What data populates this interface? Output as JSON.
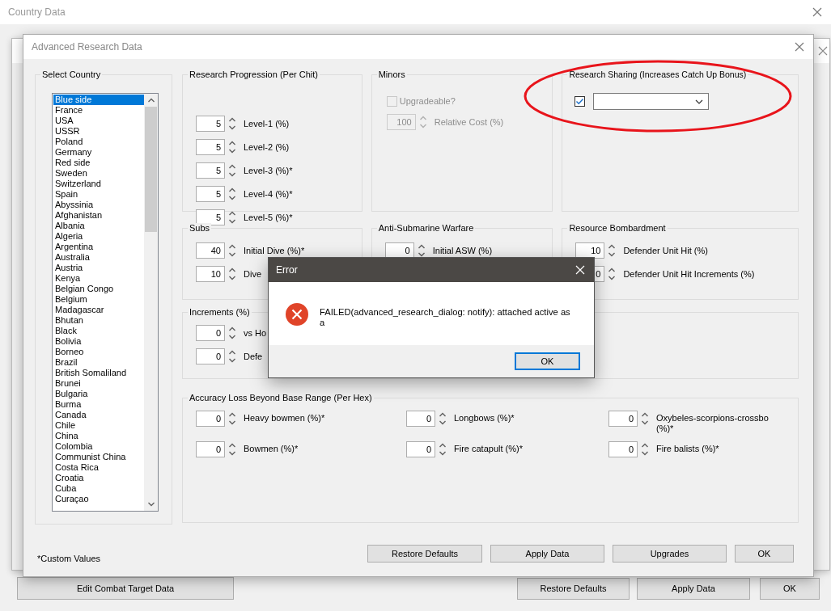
{
  "background_window": {
    "title": "Country Data",
    "buttons": [
      {
        "label": "Edit Combat Target Data"
      },
      {
        "label": "Restore Defaults"
      },
      {
        "label": "Apply Data"
      },
      {
        "label": "OK"
      }
    ]
  },
  "dialog": {
    "title": "Advanced Research Data",
    "country_list": {
      "title": "Select Country",
      "items": [
        {
          "label": "Blue side",
          "selected": true
        },
        {
          "label": "France",
          "selected": false
        },
        {
          "label": "USA",
          "selected": false
        },
        {
          "label": "USSR",
          "selected": false
        },
        {
          "label": "Poland",
          "selected": false
        },
        {
          "label": "Germany",
          "selected": false
        },
        {
          "label": "Red side",
          "selected": false
        },
        {
          "label": "Sweden",
          "selected": false
        },
        {
          "label": "Switzerland",
          "selected": false
        },
        {
          "label": "Spain",
          "selected": false
        },
        {
          "label": "Abyssinia",
          "selected": false
        },
        {
          "label": "Afghanistan",
          "selected": false
        },
        {
          "label": "Albania",
          "selected": false
        },
        {
          "label": "Algeria",
          "selected": false
        },
        {
          "label": "Argentina",
          "selected": false
        },
        {
          "label": "Australia",
          "selected": false
        },
        {
          "label": "Austria",
          "selected": false
        },
        {
          "label": "Kenya",
          "selected": false
        },
        {
          "label": "Belgian Congo",
          "selected": false
        },
        {
          "label": "Belgium",
          "selected": false
        },
        {
          "label": "Madagascar",
          "selected": false
        },
        {
          "label": "Bhutan",
          "selected": false
        },
        {
          "label": "Black",
          "selected": false
        },
        {
          "label": "Bolivia",
          "selected": false
        },
        {
          "label": "Borneo",
          "selected": false
        },
        {
          "label": "Brazil",
          "selected": false
        },
        {
          "label": "British Somaliland",
          "selected": false
        },
        {
          "label": "Brunei",
          "selected": false
        },
        {
          "label": "Bulgaria",
          "selected": false
        },
        {
          "label": "Burma",
          "selected": false
        },
        {
          "label": "Canada",
          "selected": false
        },
        {
          "label": "Chile",
          "selected": false
        },
        {
          "label": "China",
          "selected": false
        },
        {
          "label": "Colombia",
          "selected": false
        },
        {
          "label": "Communist China",
          "selected": false
        },
        {
          "label": "Costa Rica",
          "selected": false
        },
        {
          "label": "Croatia",
          "selected": false
        },
        {
          "label": "Cuba",
          "selected": false
        },
        {
          "label": "Curaçao",
          "selected": false
        }
      ]
    },
    "research_progression": {
      "title": "Research Progression (Per Chit)",
      "fields": [
        {
          "value": "5",
          "label": "Level-1 (%)"
        },
        {
          "value": "5",
          "label": "Level-2 (%)"
        },
        {
          "value": "5",
          "label": "Level-3 (%)*"
        },
        {
          "value": "5",
          "label": "Level-4 (%)*"
        },
        {
          "value": "5",
          "label": "Level-5 (%)*"
        }
      ]
    },
    "minors": {
      "title": "Minors",
      "upgradeable": {
        "label": "Upgradeable?",
        "checked": false,
        "disabled": true
      },
      "fields": [
        {
          "value": "100",
          "label": "Relative Cost (%)",
          "disabled": true
        }
      ]
    },
    "research_sharing": {
      "title": "Research Sharing (Increases Catch Up Bonus)",
      "checked": true
    },
    "subs": {
      "title": "Subs",
      "fields": [
        {
          "value": "40",
          "label": "Initial Dive (%)*"
        },
        {
          "value": "10",
          "label": "Dive"
        }
      ]
    },
    "asw": {
      "title": "Anti-Submarine Warfare",
      "fields": [
        {
          "value": "0",
          "label": "Initial ASW (%)"
        }
      ]
    },
    "resource_bombardment": {
      "title": "Resource Bombardment",
      "fields": [
        {
          "value": "10",
          "label": "Defender Unit Hit (%)"
        },
        {
          "value": "0",
          "label": "Defender Unit Hit Increments (%)"
        }
      ]
    },
    "increments": {
      "title": "Increments (%)",
      "fields": [
        {
          "value": "0",
          "label": "vs Ho"
        },
        {
          "value": "0",
          "label": "Defe"
        }
      ]
    },
    "accuracy_loss": {
      "title": "Accuracy Loss Beyond Base Range (Per Hex)",
      "fields": [
        {
          "value": "0",
          "label": "Heavy bowmen (%)*"
        },
        {
          "value": "0",
          "label": "Longbows (%)*"
        },
        {
          "value": "0",
          "label": "Oxybeles-scorpions-crossbo (%)*"
        },
        {
          "value": "0",
          "label": "Bowmen (%)*"
        },
        {
          "value": "0",
          "label": "Fire catapult (%)*"
        },
        {
          "value": "0",
          "label": "Fire balists (%)*"
        }
      ]
    },
    "footnote": "*Custom Values",
    "buttons": [
      {
        "label": "Restore Defaults"
      },
      {
        "label": "Apply Data"
      },
      {
        "label": "Upgrades"
      },
      {
        "label": "OK"
      }
    ]
  },
  "error_dialog": {
    "title": "Error",
    "message": "FAILED(advanced_research_dialog: notify):  attached active as a",
    "buttons": [
      {
        "label": "OK",
        "focused": true
      }
    ]
  },
  "annotation": {
    "kind": "ellipse",
    "color": "#e8141b"
  }
}
